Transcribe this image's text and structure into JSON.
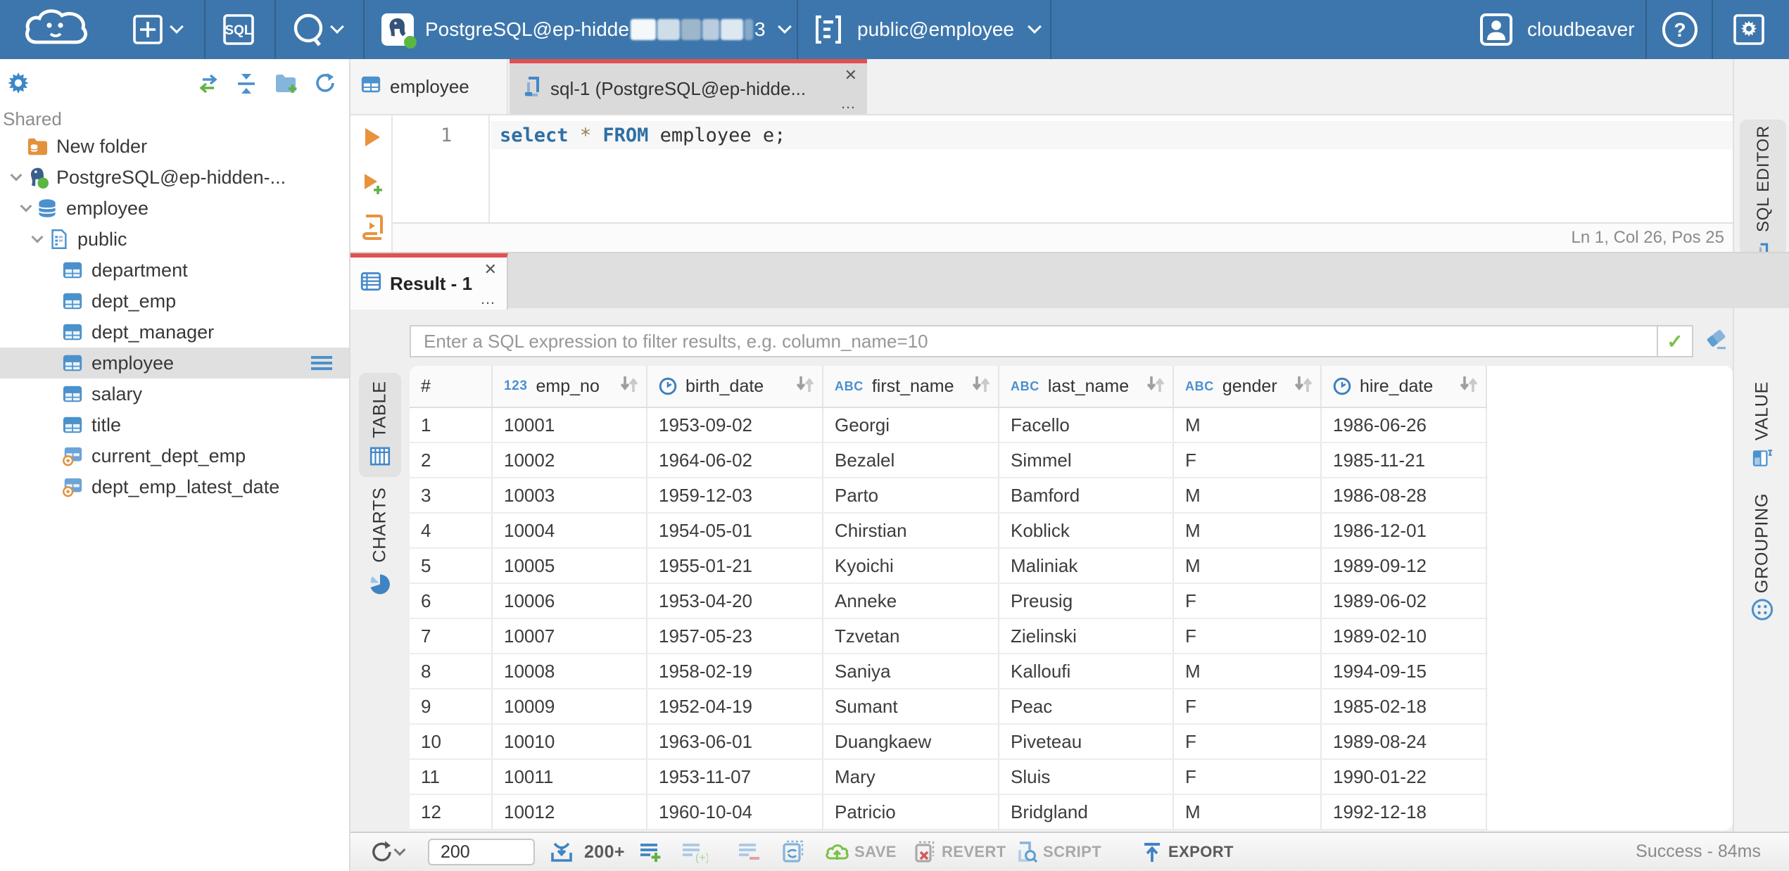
{
  "topbar": {
    "connection": "PostgreSQL@ep-hidde",
    "connection_tail": "3",
    "schema": "public@employee",
    "user": "cloudbeaver",
    "sql_button": "SQL"
  },
  "sidebar": {
    "section": "Shared",
    "items": [
      {
        "label": "New folder",
        "icon": "folder-db",
        "indent": 19,
        "chevron": false,
        "selected": false
      },
      {
        "label": "PostgreSQL@ep-hidden-...",
        "icon": "postgres",
        "indent": 4,
        "chevron": true,
        "selected": false
      },
      {
        "label": "employee",
        "icon": "database",
        "indent": 11,
        "chevron": true,
        "selected": false
      },
      {
        "label": "public",
        "icon": "schema",
        "indent": 19,
        "chevron": true,
        "selected": false
      },
      {
        "label": "department",
        "icon": "table",
        "indent": 44,
        "chevron": false,
        "selected": false
      },
      {
        "label": "dept_emp",
        "icon": "table",
        "indent": 44,
        "chevron": false,
        "selected": false
      },
      {
        "label": "dept_manager",
        "icon": "table",
        "indent": 44,
        "chevron": false,
        "selected": false
      },
      {
        "label": "employee",
        "icon": "table",
        "indent": 44,
        "chevron": false,
        "selected": true
      },
      {
        "label": "salary",
        "icon": "table",
        "indent": 44,
        "chevron": false,
        "selected": false
      },
      {
        "label": "title",
        "icon": "table",
        "indent": 44,
        "chevron": false,
        "selected": false
      },
      {
        "label": "current_dept_emp",
        "icon": "view",
        "indent": 44,
        "chevron": false,
        "selected": false
      },
      {
        "label": "dept_emp_latest_date",
        "icon": "view",
        "indent": 44,
        "chevron": false,
        "selected": false
      }
    ]
  },
  "editor": {
    "tabs": [
      {
        "label": "employee"
      },
      {
        "label": "sql-1 (PostgreSQL@ep-hidde..."
      }
    ],
    "line_number": "1",
    "tokens": [
      {
        "t": "select",
        "c": "kw"
      },
      {
        "t": " ",
        "c": "txt"
      },
      {
        "t": "*",
        "c": "op"
      },
      {
        "t": " ",
        "c": "txt"
      },
      {
        "t": "FROM",
        "c": "kw"
      },
      {
        "t": " employee e;",
        "c": "txt"
      }
    ],
    "status": "Ln 1, Col 26, Pos 25",
    "side_tab": "SQL EDITOR"
  },
  "result": {
    "tab": "Result - 1",
    "filter_placeholder": "Enter a SQL expression to filter results, e.g. column_name=10",
    "left_tabs": [
      "TABLE",
      "CHARTS"
    ],
    "right_tabs": [
      "VALUE",
      "GROUPING"
    ]
  },
  "grid": {
    "columns": [
      {
        "label": "#",
        "type": null,
        "sortable": false
      },
      {
        "label": "emp_no",
        "type": "123",
        "sortable": true
      },
      {
        "label": "birth_date",
        "type": "clock",
        "sortable": true
      },
      {
        "label": "first_name",
        "type": "abc",
        "sortable": true
      },
      {
        "label": "last_name",
        "type": "abc",
        "sortable": true
      },
      {
        "label": "gender",
        "type": "abc",
        "sortable": true
      },
      {
        "label": "hire_date",
        "type": "clock",
        "sortable": true
      }
    ],
    "rows": [
      [
        "1",
        "10001",
        "1953-09-02",
        "Georgi",
        "Facello",
        "M",
        "1986-06-26"
      ],
      [
        "2",
        "10002",
        "1964-06-02",
        "Bezalel",
        "Simmel",
        "F",
        "1985-11-21"
      ],
      [
        "3",
        "10003",
        "1959-12-03",
        "Parto",
        "Bamford",
        "M",
        "1986-08-28"
      ],
      [
        "4",
        "10004",
        "1954-05-01",
        "Chirstian",
        "Koblick",
        "M",
        "1986-12-01"
      ],
      [
        "5",
        "10005",
        "1955-01-21",
        "Kyoichi",
        "Maliniak",
        "M",
        "1989-09-12"
      ],
      [
        "6",
        "10006",
        "1953-04-20",
        "Anneke",
        "Preusig",
        "F",
        "1989-06-02"
      ],
      [
        "7",
        "10007",
        "1957-05-23",
        "Tzvetan",
        "Zielinski",
        "F",
        "1989-02-10"
      ],
      [
        "8",
        "10008",
        "1958-02-19",
        "Saniya",
        "Kalloufi",
        "M",
        "1994-09-15"
      ],
      [
        "9",
        "10009",
        "1952-04-19",
        "Sumant",
        "Peac",
        "F",
        "1985-02-18"
      ],
      [
        "10",
        "10010",
        "1963-06-01",
        "Duangkaew",
        "Piveteau",
        "F",
        "1989-08-24"
      ],
      [
        "11",
        "10011",
        "1953-11-07",
        "Mary",
        "Sluis",
        "F",
        "1990-01-22"
      ],
      [
        "12",
        "10012",
        "1960-10-04",
        "Patricio",
        "Bridgland",
        "M",
        "1992-12-18"
      ]
    ]
  },
  "toolbar": {
    "rows_value": "200",
    "fetch_label": "200+",
    "save": "SAVE",
    "revert": "REVERT",
    "script": "SCRIPT",
    "export": "EXPORT",
    "status": "Success - 84ms"
  },
  "glyphs": {
    "close": "✕",
    "more": "…",
    "sort": "↓↑",
    "check": "✓"
  }
}
